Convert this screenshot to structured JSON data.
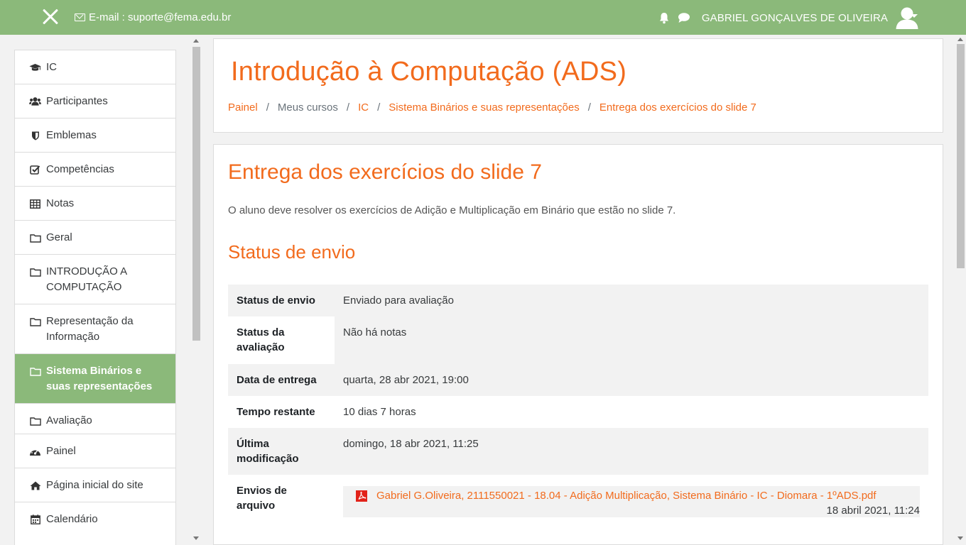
{
  "navbar": {
    "email_label": "E-mail : suporte@fema.edu.br",
    "user_name": "GABRIEL GONÇALVES DE OLIVEIRA",
    "color": "#8bb97a"
  },
  "sidebar": {
    "course_items": [
      {
        "label": "IC",
        "icon": "graduation-cap-icon"
      },
      {
        "label": "Participantes",
        "icon": "users-icon"
      },
      {
        "label": "Emblemas",
        "icon": "shield-icon"
      },
      {
        "label": "Competências",
        "icon": "checkbox-icon"
      },
      {
        "label": "Notas",
        "icon": "table-icon"
      },
      {
        "label": "Geral",
        "icon": "folder-icon"
      },
      {
        "label": "INTRODUÇÃO A COMPUTAÇÃO",
        "icon": "folder-icon"
      },
      {
        "label": "Representação da Informação",
        "icon": "folder-icon"
      },
      {
        "label": "Sistema Binários e suas representações",
        "icon": "folder-icon",
        "active": true
      },
      {
        "label": "Avaliação",
        "icon": "folder-icon"
      }
    ],
    "site_items": [
      {
        "label": "Painel",
        "icon": "dashboard-icon"
      },
      {
        "label": "Página inicial do site",
        "icon": "home-icon"
      },
      {
        "label": "Calendário",
        "icon": "calendar-icon"
      }
    ]
  },
  "header": {
    "course_title": "Introdução à Computação (ADS)",
    "breadcrumb": [
      "Painel",
      "Meus cursos",
      "IC",
      "Sistema Binários e suas representações",
      "Entrega dos exercícios do slide 7"
    ]
  },
  "main": {
    "activity_title": "Entrega dos exercícios do slide 7",
    "description": "O aluno deve resolver os exercícios de Adição e Multiplicação em Binário que estão no slide 7.",
    "section_title": "Status de envio",
    "status_rows": [
      {
        "label": "Status de envio",
        "value": "Enviado para avaliação"
      },
      {
        "label": "Status da avaliação",
        "value": "Não há notas"
      },
      {
        "label": "Data de entrega",
        "value": "quarta, 28 abr 2021, 19:00"
      },
      {
        "label": "Tempo restante",
        "value": "10 dias 7 horas"
      },
      {
        "label": "Última modificação",
        "value": "domingo, 18 abr 2021, 11:25"
      },
      {
        "label": "Envios de arquivo",
        "value": ""
      }
    ],
    "file": {
      "name": "Gabriel G.Oliveira, 2111550021 - 18.04 - Adição Multiplicação, Sistema Binário - IC - Diomara - 1ºADS.pdf",
      "date": "18 abril 2021, 11:24"
    },
    "accent_color": "#f26b1d"
  }
}
